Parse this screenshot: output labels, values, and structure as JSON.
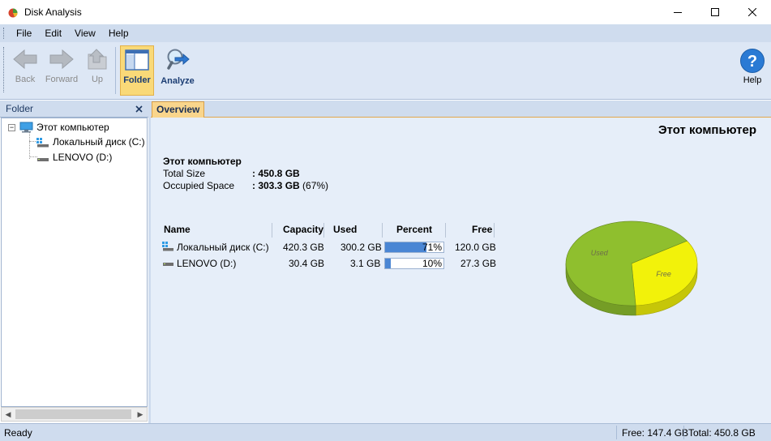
{
  "window": {
    "title": "Disk Analysis",
    "icon": "app-icon"
  },
  "menu": [
    "File",
    "Edit",
    "View",
    "Help"
  ],
  "toolbar": {
    "back": "Back",
    "forward": "Forward",
    "up": "Up",
    "folder": "Folder",
    "analyze": "Analyze",
    "help": "Help"
  },
  "left_panel": {
    "header": "Folder",
    "tree": {
      "root": "Этот компьютер",
      "children": [
        "Локальный диск (C:)",
        "LENOVO (D:)"
      ]
    }
  },
  "tabs": [
    "Overview"
  ],
  "overview": {
    "title": "Этот компьютер",
    "name": "Этот компьютер",
    "total_size_label": "Total Size",
    "total_size_value": ": 450.8 GB",
    "occupied_label": "Occupied Space",
    "occupied_value_bold": ": 303.3 GB",
    "occupied_value_pct": " (67%)",
    "columns": [
      "Name",
      "Capacity",
      "Used",
      "Percent",
      "Free"
    ],
    "rows": [
      {
        "name": "Локальный диск (C:)",
        "capacity": "420.3 GB",
        "used": "300.2 GB",
        "percent_label": "71%",
        "percent": 71,
        "free": "120.0 GB"
      },
      {
        "name": "LENOVO (D:)",
        "capacity": "30.4 GB",
        "used": "3.1 GB",
        "percent_label": "10%",
        "percent": 10,
        "free": "27.3 GB"
      }
    ]
  },
  "chart_data": {
    "type": "pie",
    "slices": [
      {
        "label": "Used",
        "value": 67,
        "color": "#8fbf2e"
      },
      {
        "label": "Free",
        "value": 33,
        "color": "#f2f20a"
      }
    ]
  },
  "status": {
    "ready": "Ready",
    "free": "Free: 147.4 GB",
    "total": "Total: 450.8 GB"
  },
  "colors": {
    "menubar": "#cfdcee",
    "content_bg": "#e6eef9",
    "active_tool": "#f9d978",
    "bar": "#4a86d4"
  }
}
